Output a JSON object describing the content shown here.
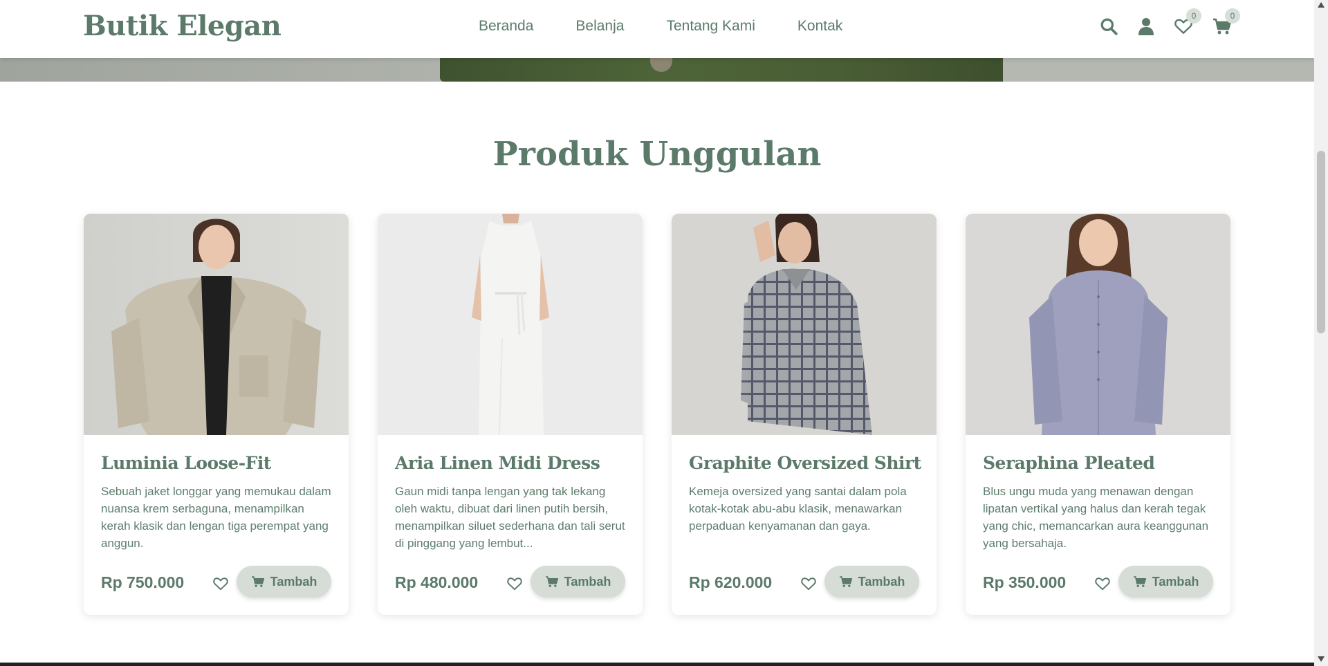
{
  "brand": "Butik Elegan",
  "nav": [
    "Beranda",
    "Belanja",
    "Tentang Kami",
    "Kontak"
  ],
  "header_icons": {
    "search": "search-icon",
    "user": "user-icon",
    "wishlist": "heart-icon",
    "wishlist_count": "0",
    "cart": "cart-icon",
    "cart_count": "0"
  },
  "section": {
    "title": "Produk Unggulan"
  },
  "products": [
    {
      "name": "Luminia Loose-Fit",
      "description": "Sebuah jaket longgar yang memukau dalam nuansa krem serbaguna, menampilkan kerah klasik dan lengan tiga perempat yang anggun.",
      "price": "Rp 750.000",
      "add_label": "Tambah"
    },
    {
      "name": "Aria Linen Midi Dress",
      "description": "Gaun midi tanpa lengan yang tak lekang oleh waktu, dibuat dari linen putih bersih, menampilkan siluet sederhana dan tali serut di pinggang yang lembut...",
      "price": "Rp 480.000",
      "add_label": "Tambah"
    },
    {
      "name": "Graphite Oversized Shirt",
      "description": "Kemeja oversized yang santai dalam pola kotak-kotak abu-abu klasik, menawarkan perpaduan kenyamanan dan gaya.",
      "price": "Rp 620.000",
      "add_label": "Tambah"
    },
    {
      "name": "Seraphina Pleated",
      "description": "Blus ungu muda yang menawan dengan lipatan vertikal yang halus dan kerah tegak yang chic, memancarkan aura keanggunan yang bersahaja.",
      "price": "Rp 350.000",
      "add_label": "Tambah"
    }
  ],
  "colors": {
    "accent": "#5b7a6a",
    "button_bg": "#d5ddd6"
  }
}
